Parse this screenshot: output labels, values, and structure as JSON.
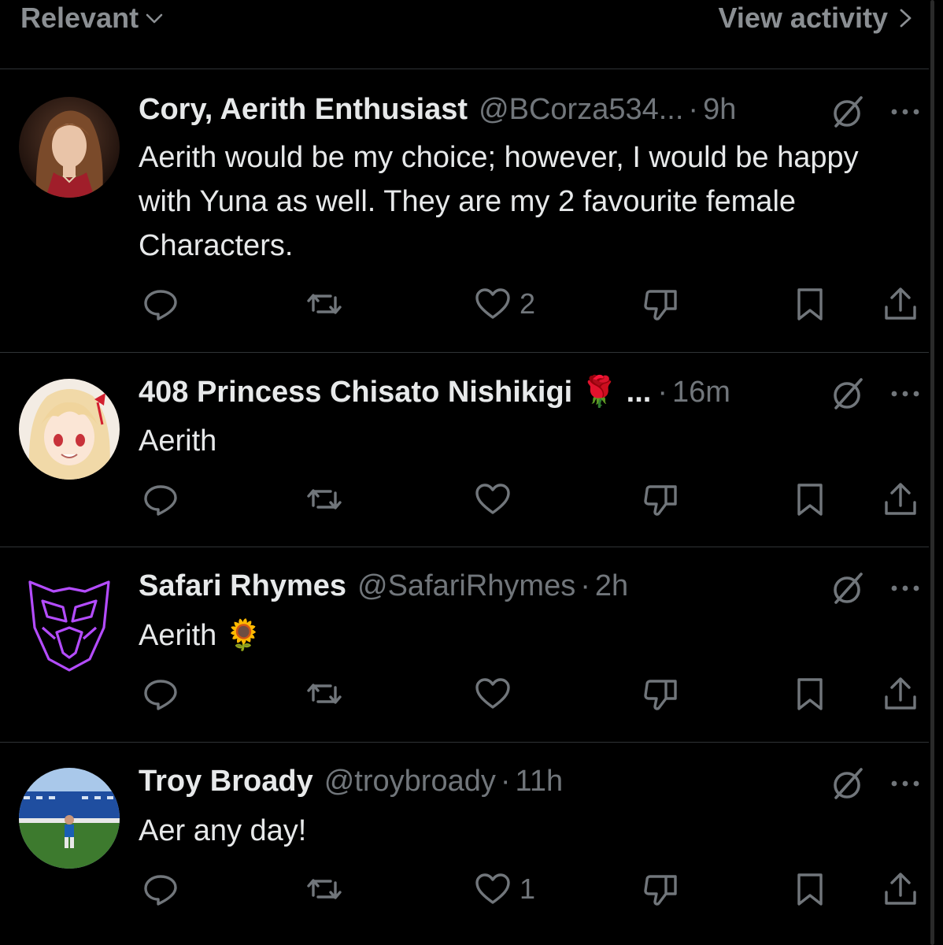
{
  "header": {
    "sort_label": "Relevant",
    "activity_label": "View activity"
  },
  "replies": [
    {
      "name": "Cory, Aerith Enthusiast",
      "handle": "@BCorza534...",
      "dot": "·",
      "time": "9h",
      "text": "Aerith would be my choice; however, I would be happy with Yuna as well.  They are my 2 favourite female Characters.",
      "likes": "2",
      "avatar": "aerith-portrait"
    },
    {
      "name": "408 Princess Chisato Nishikigi 🌹 ...",
      "handle": "",
      "dot": "·",
      "time": "16m",
      "text": "Aerith",
      "likes": "",
      "avatar": "anime-girl-portrait"
    },
    {
      "name": "Safari Rhymes",
      "handle": "@SafariRhymes",
      "dot": "·",
      "time": "2h",
      "text": "Aerith 🌻",
      "likes": "",
      "avatar": "neon-decepticon-logo"
    },
    {
      "name": "Troy Broady",
      "handle": "@troybroady",
      "dot": "·",
      "time": "11h",
      "text": "Aer any day!",
      "likes": "1",
      "avatar": "stadium-photo"
    }
  ],
  "icons": {
    "reply": "speech-bubble-icon",
    "repost": "repost-arrows-icon",
    "like": "heart-icon",
    "dislike": "thumbs-down-icon",
    "bookmark": "bookmark-icon",
    "share": "share-upload-icon",
    "grok": "grok-slash-icon",
    "more": "more-dots-icon"
  },
  "colors": {
    "background": "#000000",
    "text": "#e7e9ea",
    "muted": "#71767b",
    "divider": "#2f3336",
    "neon_purple": "#b44cff"
  }
}
